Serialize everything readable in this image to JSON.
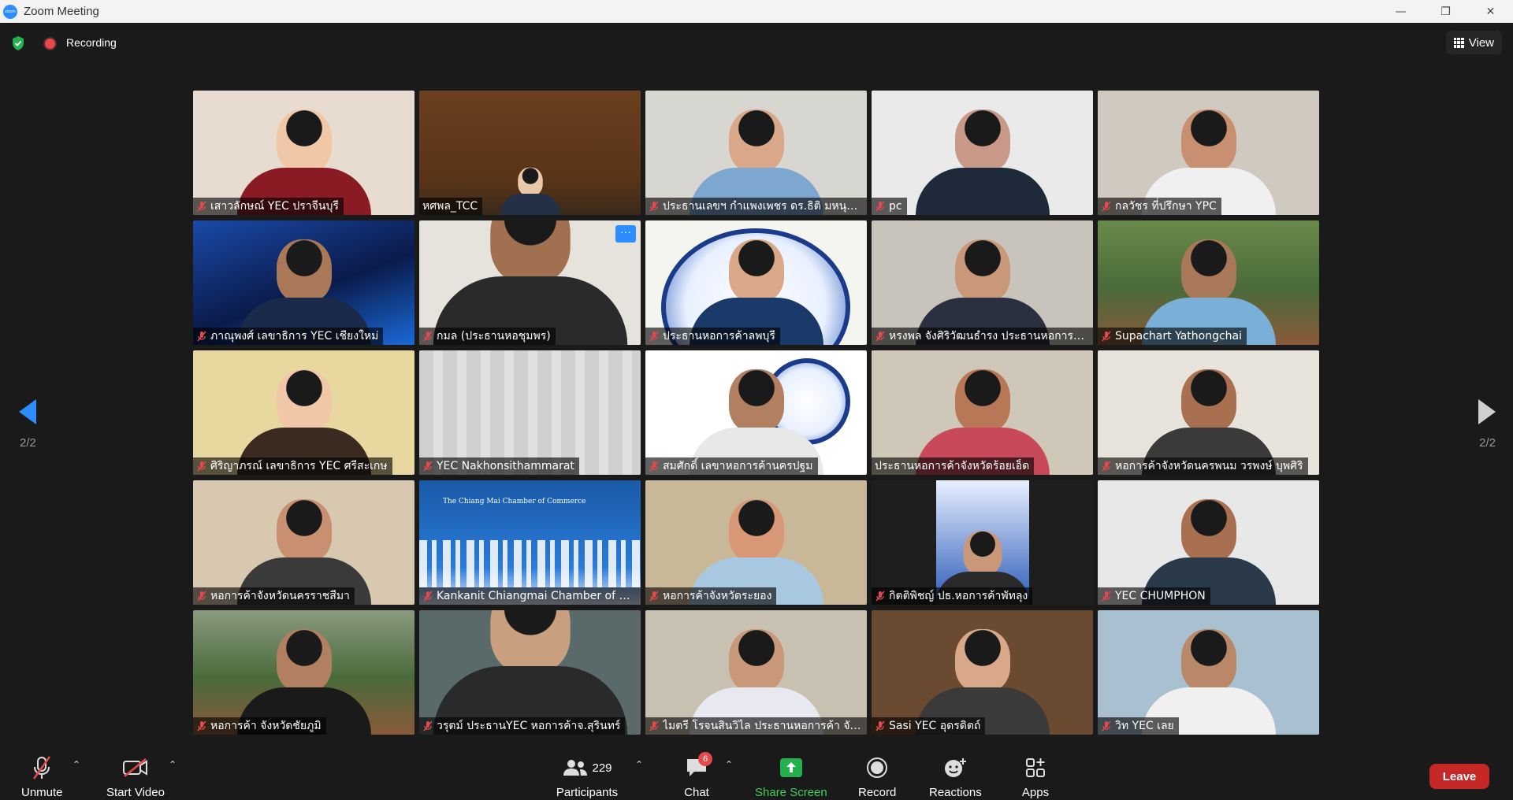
{
  "window": {
    "title": "Zoom Meeting",
    "logo_text": "zoom"
  },
  "status": {
    "recording_label": "Recording",
    "view_label": "View"
  },
  "navigation": {
    "page_indicator": "2/2"
  },
  "participants": [
    {
      "name": "เสาวลักษณ์ YEC ปราจีนบุรี",
      "muted": true,
      "bg": "#e8dcd0",
      "fg": "#f0c8a8",
      "body": "#8a1b25",
      "scene": "room"
    },
    {
      "name": "หศพล_TCC",
      "muted": false,
      "bg": "#6b3f20",
      "fg": "#e8c8a8",
      "body": "#233046",
      "scene": "office"
    },
    {
      "name": "ประธานเลขฯ กำแพงเพชร ดร.ธิติ มหนุญ...",
      "muted": true,
      "bg": "#d8d6d0",
      "fg": "#d8a888",
      "body": "#7da6d0",
      "scene": "room"
    },
    {
      "name": "pc",
      "muted": true,
      "bg": "#eaeaea",
      "fg": "#c89888",
      "body": "#1e2a3a",
      "scene": "room"
    },
    {
      "name": "กลวัชร ที่ปรึกษา YPC",
      "muted": true,
      "bg": "#cfc9c0",
      "fg": "#c89070",
      "body": "#f0f0f0",
      "scene": "shelf"
    },
    {
      "name": "ภาณุพงศ์ เลขาธิการ YEC เชียงใหม่",
      "muted": true,
      "bg": "#0d2a6a",
      "fg": "#a87858",
      "body": "#1a2a4a",
      "scene": "banner"
    },
    {
      "name": "กมล (ประธานหอชุมพร)",
      "muted": true,
      "bg": "#e6e2dc",
      "fg": "#a07050",
      "body": "#2a2a2a",
      "scene": "close",
      "more": "···"
    },
    {
      "name": "ประธานหอการค้าลพบุรี",
      "muted": true,
      "bg": "#f5f5f0",
      "fg": "#d8a888",
      "body": "#1a3a6a",
      "scene": "emblem"
    },
    {
      "name": "หรงพล จังศิริวัฒนธำรง ประธานหอการค้...",
      "muted": true,
      "bg": "#c8c4bc",
      "fg": "#c89878",
      "body": "#2a3040",
      "scene": "room"
    },
    {
      "name": "Supachart Yathongchai",
      "muted": true,
      "bg": "#6a8a4a",
      "fg": "#a87858",
      "body": "#7ab0d8",
      "scene": "outdoor"
    },
    {
      "name": "ศิริญาภรณ์ เลขาธิการ YEC ศรีสะเกษ",
      "muted": true,
      "bg": "#e8d8a0",
      "fg": "#f0c8a8",
      "body": "#3a2a20",
      "scene": "poster"
    },
    {
      "name": "YEC Nakhonsithammarat",
      "muted": true,
      "bg": "#d8d8d8",
      "fg": "#d8d8d8",
      "body": "#d8d8d8",
      "scene": "curtain"
    },
    {
      "name": "สมศักดิ์ เลขาหอการค้านครปฐม",
      "muted": true,
      "bg": "#ffffff",
      "fg": "#b08060",
      "body": "#e8e8e8",
      "scene": "logo90"
    },
    {
      "name": "ประธานหอการค้าจังหวัดร้อยเอ็ด",
      "muted": false,
      "bg": "#cfc8b8",
      "fg": "#b87858",
      "body": "#c84a5a",
      "scene": "room",
      "active": true
    },
    {
      "name": "หอการค้าจังหวัดนครพนม วรพงษ์ บุพศิริ",
      "muted": true,
      "bg": "#e8e4dc",
      "fg": "#a87050",
      "body": "#3a3a3a",
      "scene": "plant"
    },
    {
      "name": "หอการค้าจังหวัดนครราชสีมา",
      "muted": true,
      "bg": "#d8c8b0",
      "fg": "#c89070",
      "body": "#3a3a3a",
      "scene": "shrine"
    },
    {
      "name": "Kankanit Chiangmai Chamber of C...",
      "muted": true,
      "bg": "#1a5aa8",
      "fg": "#1a5aa8",
      "body": "#1a5aa8",
      "scene": "city",
      "banner_text": "The Chiang Mai Chamber of Commerce"
    },
    {
      "name": "หอการค้าจังหวัดระยอง",
      "muted": true,
      "bg": "#c8b898",
      "fg": "#d89878",
      "body": "#a8c8e0",
      "scene": "room"
    },
    {
      "name": "กิตติพิชญ์ ปธ.หอการค้าพัทลุง",
      "muted": true,
      "bg": "#1e1e1e",
      "fg": "#c89878",
      "body": "#2a2a2a",
      "scene": "portrait"
    },
    {
      "name": "YEC CHUMPHON",
      "muted": true,
      "bg": "#e8e8e8",
      "fg": "#a87050",
      "body": "#2a3a4a",
      "scene": "room"
    },
    {
      "name": "หอการค้า จังหวัดชัยภูมิ",
      "muted": true,
      "bg": "#8a9a80",
      "fg": "#b08060",
      "body": "#1a1a1a",
      "scene": "outdoor"
    },
    {
      "name": "วรุตม์ ประธานYEC หอการค้าจ.สุรินทร์",
      "muted": true,
      "bg": "#5a6a6a",
      "fg": "#c8a080",
      "body": "#2a2a2a",
      "scene": "close"
    },
    {
      "name": "ไมตรี โรจนสินวิไล ประธานหอการค้า จัง...",
      "muted": true,
      "bg": "#c8c0b0",
      "fg": "#c89878",
      "body": "#e8e8f0",
      "scene": "room"
    },
    {
      "name": "Sasi YEC อุดรดิตถ์",
      "muted": true,
      "bg": "#6a4a30",
      "fg": "#d8a888",
      "body": "#3a3a3a",
      "scene": "room"
    },
    {
      "name": "วิท YEC เลย",
      "muted": true,
      "bg": "#a8c0d0",
      "fg": "#b88868",
      "body": "#f0f0f0",
      "scene": "room"
    }
  ],
  "toolbar": {
    "unmute_label": "Unmute",
    "start_video_label": "Start Video",
    "participants_label": "Participants",
    "participants_count": "229",
    "chat_label": "Chat",
    "chat_badge": "6",
    "share_label": "Share Screen",
    "record_label": "Record",
    "reactions_label": "Reactions",
    "apps_label": "Apps",
    "leave_label": "Leave"
  },
  "colors": {
    "accent": "#2d8cff",
    "share_green": "#3ecf5e",
    "leave_red": "#c62828",
    "active_speaker": "#e8e35a",
    "mic_off_red": "#e5484d"
  }
}
